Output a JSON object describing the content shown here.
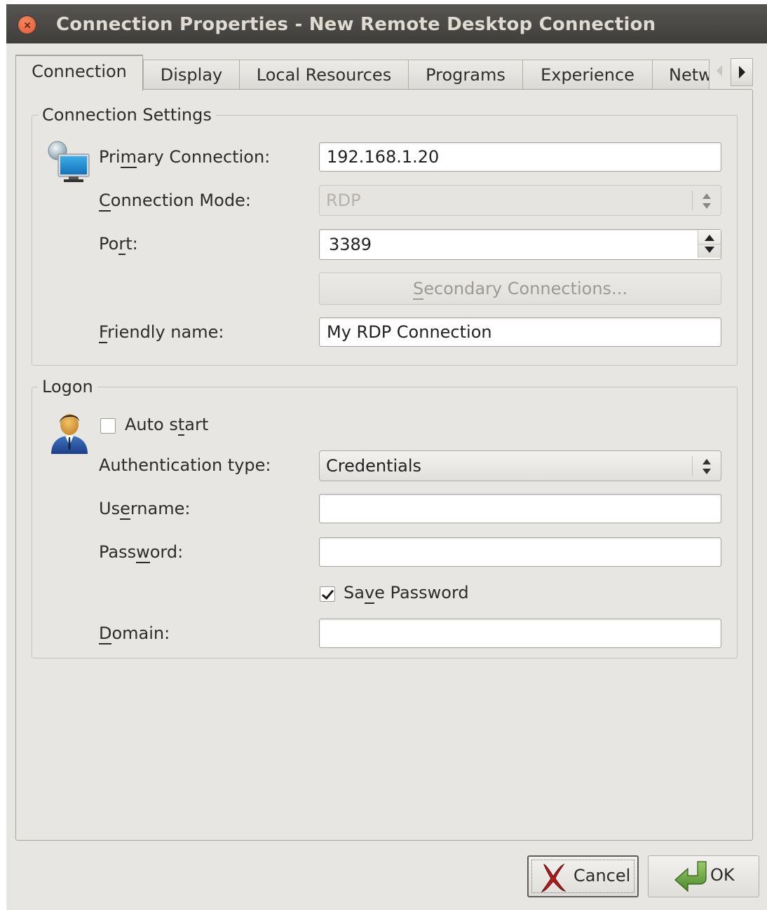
{
  "window": {
    "title": "Connection Properties - New Remote Desktop Connection"
  },
  "tabs": [
    {
      "label": "Connection",
      "active": true
    },
    {
      "label": "Display"
    },
    {
      "label": "Local Resources"
    },
    {
      "label": "Programs"
    },
    {
      "label": "Experience"
    },
    {
      "label": "Netw"
    }
  ],
  "connection_settings": {
    "legend": "Connection Settings",
    "icon": "network-computer-icon",
    "primary_connection": {
      "label_pre": "Pri",
      "label_key": "m",
      "label_post": "ary Connection:",
      "value": "192.168.1.20"
    },
    "connection_mode": {
      "label_pre": "",
      "label_key": "C",
      "label_post": "onnection Mode:",
      "value": "RDP",
      "disabled": true
    },
    "port": {
      "label_pre": "Po",
      "label_key": "r",
      "label_post": "t:",
      "value": "3389"
    },
    "secondary_button": {
      "label_pre": "",
      "label_key": "S",
      "label_post": "econdary Connections...",
      "disabled": true
    },
    "friendly_name": {
      "label_pre": "",
      "label_key": "F",
      "label_post": "riendly name:",
      "value": "My RDP Connection"
    }
  },
  "logon": {
    "legend": "Logon",
    "icon": "user-icon",
    "auto_start": {
      "label_pre": "Auto s",
      "label_key": "t",
      "label_post": "art",
      "checked": false
    },
    "auth_type": {
      "label": "Authentication type:",
      "value": "Credentials"
    },
    "username": {
      "label_pre": "Us",
      "label_key": "e",
      "label_post": "rname:",
      "value": ""
    },
    "password": {
      "label_pre": "Pass",
      "label_key": "w",
      "label_post": "ord:",
      "value": ""
    },
    "save_password": {
      "label_pre": "Sa",
      "label_key": "v",
      "label_post": "e Password",
      "checked": true
    },
    "domain": {
      "label_pre": "",
      "label_key": "D",
      "label_post": "omain:",
      "value": ""
    }
  },
  "buttons": {
    "cancel": {
      "label": "Cancel",
      "icon": "cancel-x-icon"
    },
    "ok": {
      "label": "OK",
      "icon": "ok-arrow-icon"
    }
  },
  "colors": {
    "titlebar": "#3f3e3b",
    "window_bg": "#e8e6e3",
    "close_button": "#e05a32"
  }
}
